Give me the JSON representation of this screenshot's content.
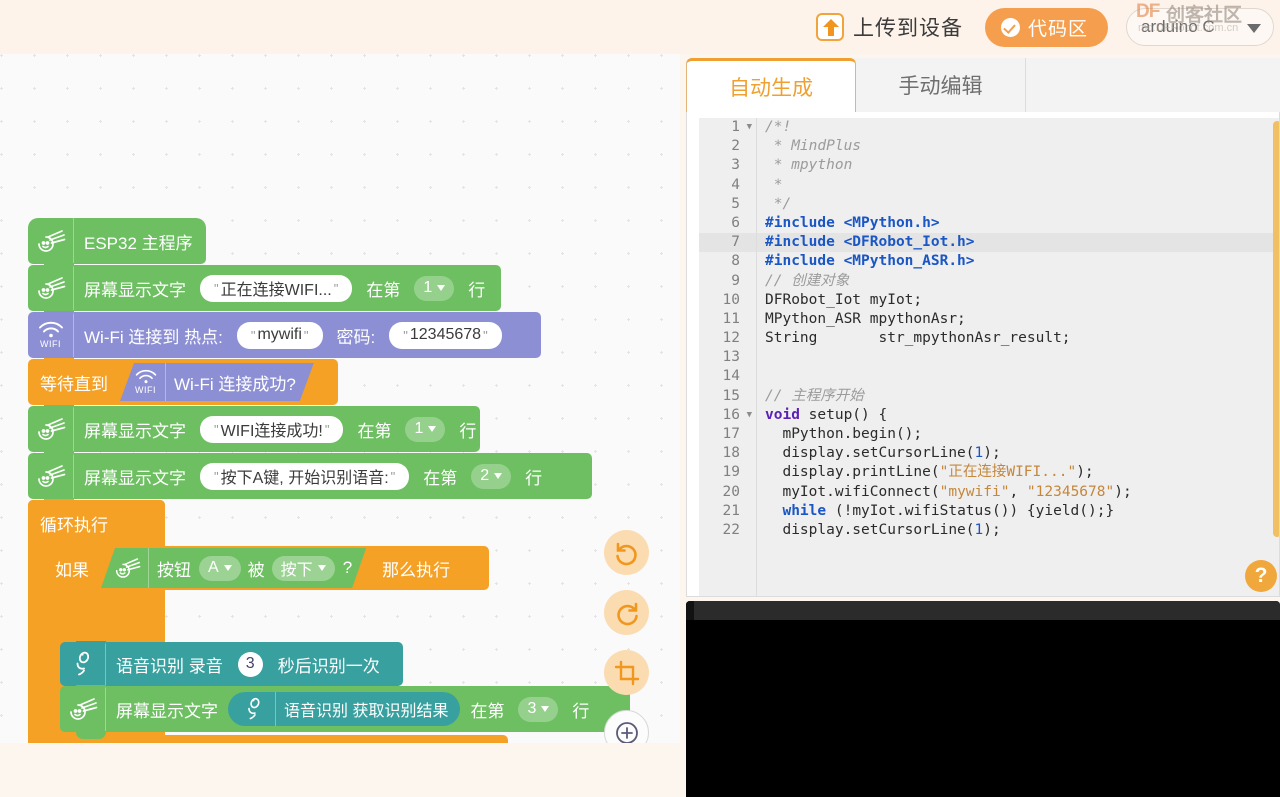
{
  "topbar": {
    "upload_label": "上传到设备",
    "upload_icon": "upload-arrow-icon",
    "code_area_label": "代码区",
    "code_area_icon": "check-circle-icon",
    "lang_value": "arduino C",
    "caret_icon": "chevron-down-icon",
    "accent": "#f59e4e"
  },
  "watermark": {
    "df": "DF",
    "community": "创客社区",
    "url": "mc.DFRobot.com.cn"
  },
  "tabs": [
    {
      "label": "自动生成",
      "active": true
    },
    {
      "label": "手动编辑",
      "active": false
    }
  ],
  "blocks": {
    "b_main": {
      "icon": "mpython-icon",
      "text": "ESP32 主程序"
    },
    "b_disp1": {
      "icon": "mpython-icon",
      "text": "屏幕显示文字",
      "value": "正在连接WIFI...",
      "mid": "在第",
      "line": "1",
      "tail": "行"
    },
    "b_wifi": {
      "icon": "wifi-icon",
      "icon_label": "WIFI",
      "text": "Wi-Fi 连接到 热点:",
      "ssid": "mywifi",
      "pw_label": "密码:",
      "password": "12345678"
    },
    "b_wait": {
      "text": "等待直到",
      "icon": "wifi-icon",
      "icon_label": "WIFI",
      "cond": "Wi-Fi 连接成功?"
    },
    "b_disp2": {
      "icon": "mpython-icon",
      "text": "屏幕显示文字",
      "value": "WIFI连接成功!",
      "mid": "在第",
      "line": "1",
      "tail": "行"
    },
    "b_disp3": {
      "icon": "mpython-icon",
      "text": "屏幕显示文字",
      "value": "按下A键, 开始识别语音:",
      "mid": "在第",
      "line": "2",
      "tail": "行"
    },
    "b_loop": {
      "text": "循环执行"
    },
    "b_if": {
      "text": "如果",
      "icon": "mpython-icon",
      "cond_label": "按钮",
      "button": "A",
      "mid": "被",
      "state": "按下",
      "qmark": "?",
      "then": "那么执行"
    },
    "b_asr_rec": {
      "icon": "microphone-icon",
      "text": "语音识别 录音",
      "seconds": "3",
      "tail": "秒后识别一次"
    },
    "b_disp4": {
      "icon": "mpython-icon",
      "text": "屏幕显示文字",
      "inner_icon": "microphone-icon",
      "inner": "语音识别 获取识别结果",
      "mid": "在第",
      "line": "3",
      "tail": "行"
    }
  },
  "fabs": [
    {
      "name": "undo-icon"
    },
    {
      "name": "redo-icon"
    },
    {
      "name": "crop-icon"
    },
    {
      "name": "zoom-in-icon"
    }
  ],
  "code": {
    "lines": [
      {
        "n": "1",
        "fold": true
      },
      {
        "n": "2"
      },
      {
        "n": "3"
      },
      {
        "n": "4"
      },
      {
        "n": "5"
      },
      {
        "n": "6"
      },
      {
        "n": "7",
        "hl": true
      },
      {
        "n": "8"
      },
      {
        "n": "9"
      },
      {
        "n": "10"
      },
      {
        "n": "11"
      },
      {
        "n": "12"
      },
      {
        "n": "13"
      },
      {
        "n": "14"
      },
      {
        "n": "15"
      },
      {
        "n": "16",
        "fold": true
      },
      {
        "n": "17"
      },
      {
        "n": "18"
      },
      {
        "n": "19"
      },
      {
        "n": "20"
      },
      {
        "n": "21"
      },
      {
        "n": "22"
      }
    ],
    "text": [
      "/*!",
      " * MindPlus",
      " * mpython",
      " *",
      " */",
      "#include <MPython.h>",
      "#include <DFRobot_Iot.h>",
      "#include <MPython_ASR.h>",
      "// 创建对象",
      "DFRobot_Iot myIot;",
      "MPython_ASR mpythonAsr;",
      "String       str_mpythonAsr_result;",
      "",
      "",
      "// 主程序开始",
      "void setup() {",
      "  mPython.begin();",
      "  display.setCursorLine(1);",
      "  display.printLine(\"正在连接WIFI...\");",
      "  myIot.wifiConnect(\"mywifi\", \"12345678\");",
      "  while (!myIot.wifiStatus()) {yield();}",
      "  display.setCursorLine(1);"
    ]
  },
  "help": {
    "label": "?"
  }
}
